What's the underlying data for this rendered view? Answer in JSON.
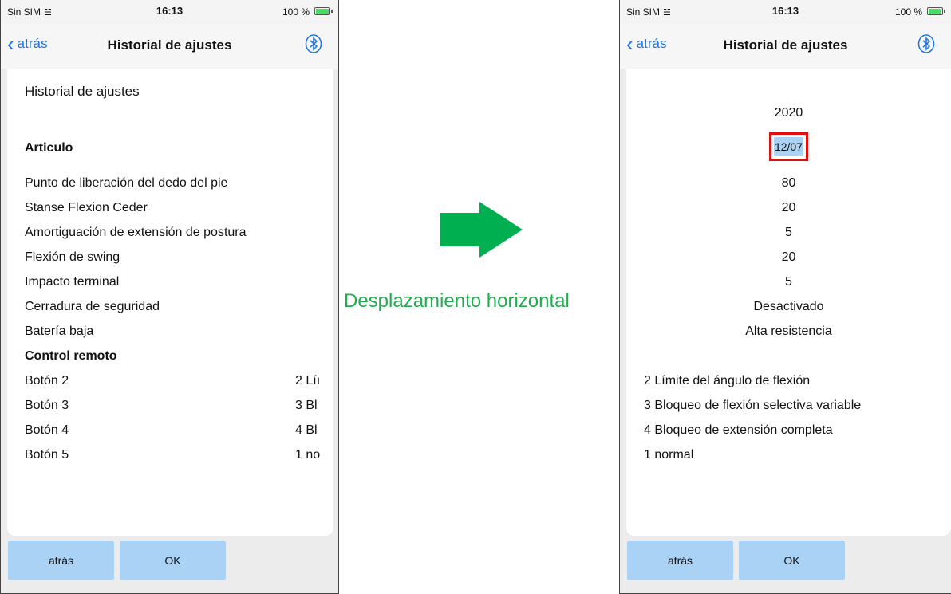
{
  "status": {
    "carrier": "Sin SIM",
    "time": "16:13",
    "battery": "100 %"
  },
  "nav": {
    "back_label": "atrás",
    "title": "Historial de ajustes"
  },
  "left": {
    "heading": "Historial de ajustes",
    "section_article": "Articulo",
    "items": [
      "Punto de liberación del dedo del pie",
      "Stanse Flexion Ceder",
      "Amortiguación de extensión de postura",
      "Flexión de swing",
      "Impacto terminal",
      "Cerradura de seguridad",
      "Batería baja"
    ],
    "section_remote": "Control remoto",
    "buttons": [
      {
        "label": "Botón 2",
        "value": "2 Líı"
      },
      {
        "label": "Botón 3",
        "value": "3 Bl"
      },
      {
        "label": "Botón 4",
        "value": "4 Bl"
      },
      {
        "label": "Botón 5",
        "value": "1 no"
      }
    ]
  },
  "right": {
    "year": "2020",
    "date": "12/07",
    "values": [
      "80",
      "20",
      "5",
      "20",
      "5",
      "Desactivado",
      "Alta resistencia"
    ],
    "remote_values": [
      "2 Límite del ángulo de flexión",
      "3 Bloqueo de flexión selectiva variable",
      "4 Bloqueo de extensión completa",
      "1 normal"
    ]
  },
  "bottom": {
    "back_label": "atrás",
    "ok_label": "OK"
  },
  "caption": "Desplazamiento horizontal",
  "colors": {
    "accent": "#1a73e8",
    "button": "#a9d2f5",
    "arrow": "#00b050",
    "highlight_border": "#e01010"
  }
}
